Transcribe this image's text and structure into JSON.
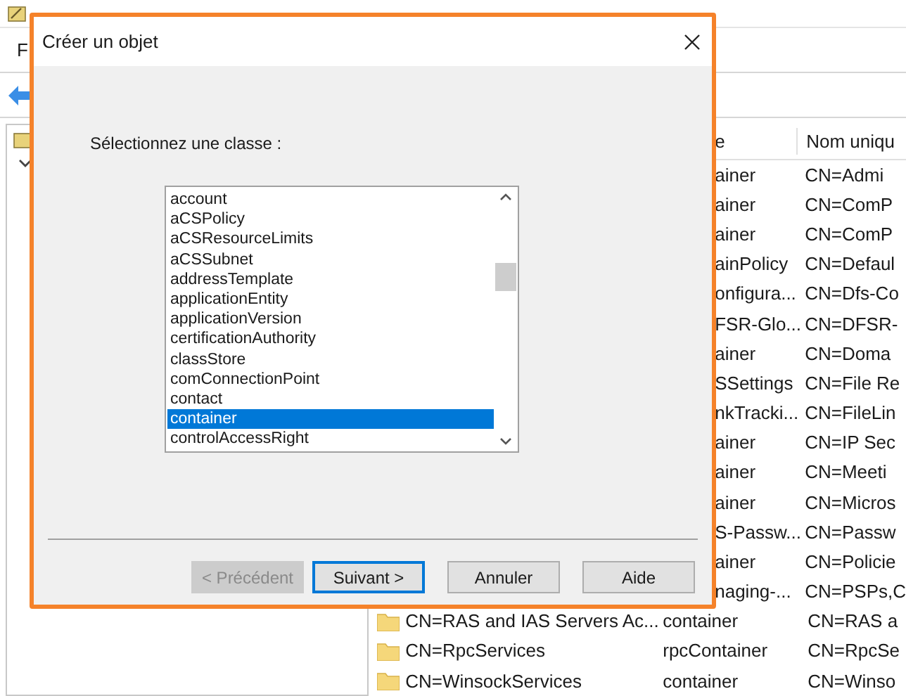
{
  "app": {
    "menu": [
      "F"
    ]
  },
  "table": {
    "columns": [
      "e",
      "Nom uniqu"
    ],
    "rows": [
      {
        "kind": "covered",
        "type": "ainer",
        "dn": "CN=Admi"
      },
      {
        "kind": "covered",
        "type": "ainer",
        "dn": "CN=ComP"
      },
      {
        "kind": "covered",
        "type": "ainer",
        "dn": "CN=ComP"
      },
      {
        "kind": "covered",
        "type": "ainPolicy",
        "dn": "CN=Defaul"
      },
      {
        "kind": "covered",
        "type": "onfigura...",
        "dn": "CN=Dfs-Co"
      },
      {
        "kind": "covered",
        "type": "FSR-Glo...",
        "dn": "CN=DFSR-"
      },
      {
        "kind": "covered",
        "type": "ainer",
        "dn": "CN=Doma"
      },
      {
        "kind": "covered",
        "type": "SSettings",
        "dn": "CN=File Re"
      },
      {
        "kind": "covered",
        "type": "nkTracki...",
        "dn": "CN=FileLin"
      },
      {
        "kind": "covered",
        "type": "ainer",
        "dn": "CN=IP Sec"
      },
      {
        "kind": "covered",
        "type": "ainer",
        "dn": "CN=Meeti"
      },
      {
        "kind": "covered",
        "type": "ainer",
        "dn": "CN=Micros"
      },
      {
        "kind": "covered",
        "type": "S-Passw...",
        "dn": "CN=Passw"
      },
      {
        "kind": "covered",
        "type": "ainer",
        "dn": "CN=Policie"
      },
      {
        "kind": "covered",
        "type": "naging-...",
        "dn": "CN=PSPs,C"
      },
      {
        "kind": "full",
        "name": "CN=RAS and IAS Servers Ac...",
        "type": "container",
        "dn": "CN=RAS a"
      },
      {
        "kind": "full",
        "name": "CN=RpcServices",
        "type": "rpcContainer",
        "dn": "CN=RpcSe"
      },
      {
        "kind": "full",
        "name": "CN=WinsockServices",
        "type": "container",
        "dn": "CN=Winso"
      }
    ]
  },
  "dialog": {
    "title": "Créer un objet",
    "label": "Sélectionnez une classe :",
    "classes": [
      {
        "name": "account",
        "selected": false
      },
      {
        "name": "aCSPolicy",
        "selected": false
      },
      {
        "name": "aCSResourceLimits",
        "selected": false
      },
      {
        "name": "aCSSubnet",
        "selected": false
      },
      {
        "name": "addressTemplate",
        "selected": false
      },
      {
        "name": "applicationEntity",
        "selected": false
      },
      {
        "name": "applicationVersion",
        "selected": false
      },
      {
        "name": "certificationAuthority",
        "selected": false
      },
      {
        "name": "classStore",
        "selected": false
      },
      {
        "name": "comConnectionPoint",
        "selected": false
      },
      {
        "name": "contact",
        "selected": false
      },
      {
        "name": "container",
        "selected": true
      },
      {
        "name": "controlAccessRight",
        "selected": false
      }
    ],
    "buttons": [
      {
        "label": "< Précédent",
        "disabled": true,
        "default": false
      },
      {
        "label": "Suivant >",
        "disabled": false,
        "default": true
      },
      {
        "label": "Annuler",
        "disabled": false,
        "default": false
      },
      {
        "label": "Aide",
        "disabled": false,
        "default": false
      }
    ]
  }
}
